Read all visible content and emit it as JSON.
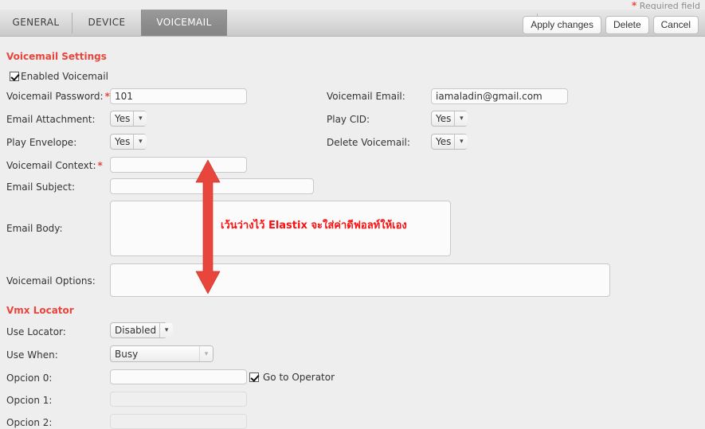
{
  "header": {
    "required_note": "Required field",
    "required_star": "*",
    "tabs": [
      {
        "id": "general",
        "label": "GENERAL",
        "active": false
      },
      {
        "id": "device",
        "label": "DEVICE",
        "active": false
      },
      {
        "id": "voicemail",
        "label": "VOICEMAIL",
        "active": true
      }
    ],
    "buttons": [
      {
        "id": "apply",
        "label": "Apply changes"
      },
      {
        "id": "delete",
        "label": "Delete"
      },
      {
        "id": "cancel",
        "label": "Cancel"
      }
    ]
  },
  "voicemail_settings": {
    "title": "Voicemail Settings",
    "enabled_voicemail": {
      "label": "Enabled Voicemail",
      "checked": true
    },
    "fields": {
      "voicemail_password": {
        "label": "Voicemail Password:",
        "required_star": "*",
        "value": "101"
      },
      "email_attachment": {
        "label": "Email Attachment:",
        "value": "Yes"
      },
      "play_envelope": {
        "label": "Play Envelope:",
        "value": "Yes"
      },
      "voicemail_context": {
        "label": "Voicemail Context:",
        "required_star": "*",
        "value": ""
      },
      "email_subject": {
        "label": "Email Subject:",
        "value": ""
      },
      "email_body": {
        "label": "Email Body:",
        "value": ""
      },
      "voicemail_options": {
        "label": "Voicemail Options:",
        "value": ""
      },
      "voicemail_email": {
        "label": "Voicemail Email:",
        "value": "iamaladin@gmail.com"
      },
      "play_cid": {
        "label": "Play CID:",
        "value": "Yes"
      },
      "delete_voicemail": {
        "label": "Delete Voicemail:",
        "value": "Yes"
      }
    }
  },
  "vmx_locator": {
    "title": "Vmx Locator",
    "fields": {
      "use_locator": {
        "label": "Use Locator:",
        "value": "Disabled"
      },
      "use_when": {
        "label": "Use When:",
        "value": "Busy"
      },
      "opcion_0": {
        "label": "Opcion 0:",
        "value": ""
      },
      "opcion_1": {
        "label": "Opcion 1:",
        "value": ""
      },
      "opcion_2": {
        "label": "Opcion 2:",
        "value": ""
      }
    },
    "go_to_operator": {
      "label": "Go to Operator",
      "checked": true
    }
  },
  "annotation": {
    "text": "เว้นว่างไว้ Elastix จะใส่ค่าดีฟอลท์ให้เอง",
    "color": "#fc1111",
    "arrow": "double-headed-vertical-arrow"
  },
  "colors": {
    "accent_red": "#e8453c",
    "annotation_red": "#fc1111",
    "page_background": "#eeeeee",
    "active_tab": "#8b8b8b"
  }
}
